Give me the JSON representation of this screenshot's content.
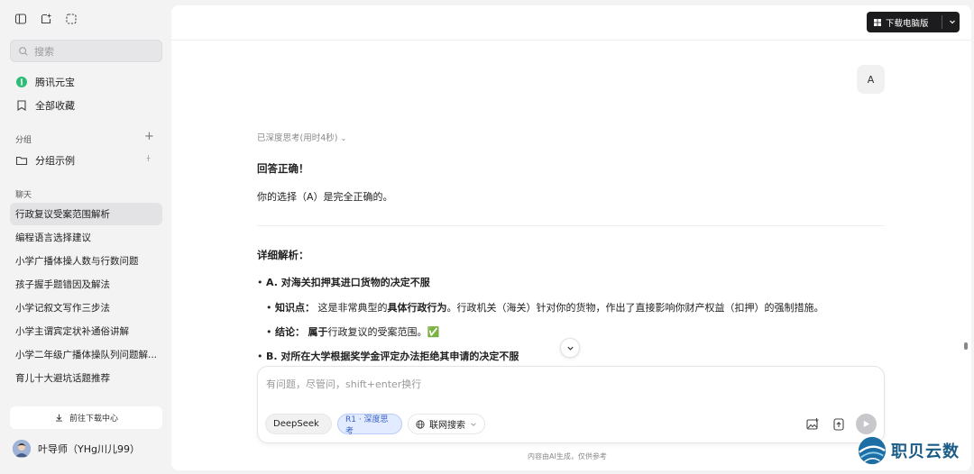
{
  "sidebar": {
    "search_placeholder": "搜索",
    "app_name": "腾讯元宝",
    "favorites": "全部收藏",
    "group_section": "分组",
    "group_example": "分组示例",
    "chat_section": "聊天",
    "chats": [
      "行政复议受案范围解析",
      "编程语言选择建议",
      "小学广播体操人数与行数问题",
      "孩子握手题错因及解法",
      "小学记叙文写作三步法",
      "小学主谓宾定状补通俗讲解",
      "小学二年级广播体操队列问题解...",
      "育儿十大避坑话题推荐"
    ],
    "download_center": "前往下载中心",
    "user_name": "叶导师（YHg川儿99）"
  },
  "header": {
    "download_pc": "下载电脑版"
  },
  "conversation": {
    "user_message": "A",
    "thinking_status": "已深度思考(用时4秒)",
    "answer_title": "回答正确！",
    "answer_body": "你的选择（A）是完全正确的。",
    "detail_title": "详细解析：",
    "item_a_title": "A. 对海关扣押其进口货物的决定不服",
    "kp_label": "知识点：",
    "kp_pre": "这是非常典型的",
    "kp_bold": "具体行政行为",
    "kp_post": "。行政机关（海关）针对你的货物，作出了直接影响你财产权益（扣押）的强制措施。",
    "conclusion_label": "结论：",
    "conclusion_bold": "属于",
    "conclusion_post": "行政复议的受案范围。✅",
    "item_b_title": "B. 对所在大学根据奖学金评定办法拒绝其申请的决定不服"
  },
  "composer": {
    "placeholder": "有问题，尽管问，shift+enter换行",
    "model": "DeepSeek",
    "deep_think": "R1 · 深度思考",
    "web_search": "联网搜索"
  },
  "footer_note": "内容由AI生成，仅供参考",
  "watermark": "职贝云数"
}
